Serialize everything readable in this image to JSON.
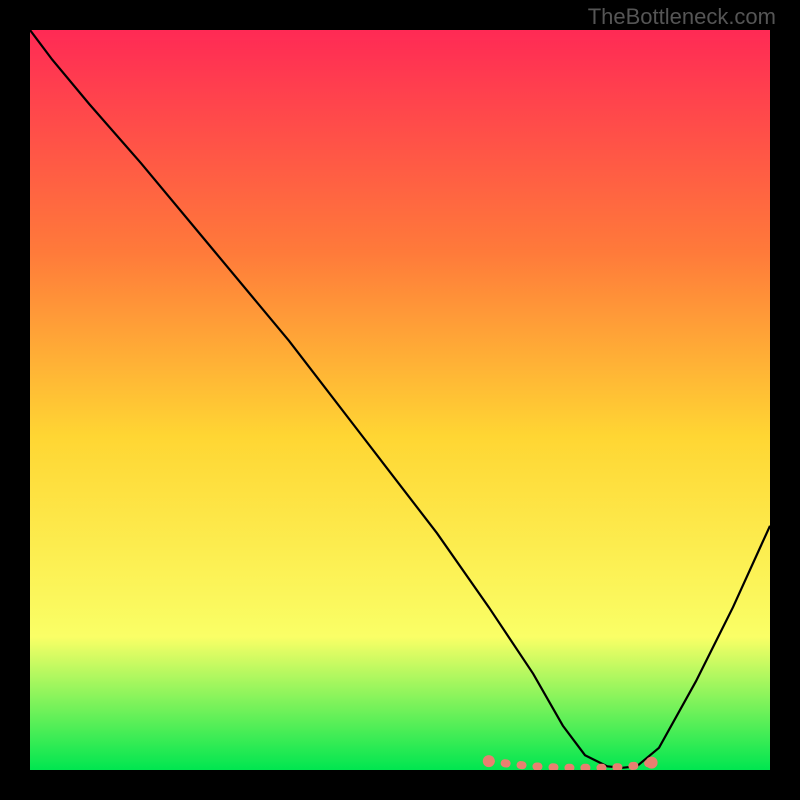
{
  "watermark": "TheBottleneck.com",
  "chart_data": {
    "type": "line",
    "title": "",
    "xlabel": "",
    "ylabel": "",
    "xlim": [
      0,
      100
    ],
    "ylim": [
      0,
      100
    ],
    "gradient_colors": {
      "top": "#ff2a55",
      "upper_mid": "#ff7a3a",
      "mid": "#ffd633",
      "lower_mid": "#faff66",
      "bottom": "#00e650"
    },
    "curve": {
      "x": [
        0,
        3,
        8,
        15,
        25,
        35,
        45,
        55,
        62,
        68,
        72,
        75,
        78,
        80,
        82,
        85,
        90,
        95,
        100
      ],
      "y": [
        100,
        96,
        90,
        82,
        70,
        58,
        45,
        32,
        22,
        13,
        6,
        2,
        0.5,
        0.3,
        0.5,
        3,
        12,
        22,
        33
      ]
    },
    "highlight_segment": {
      "color": "#e88070",
      "x": [
        62,
        65,
        68,
        70,
        72,
        74,
        76,
        78,
        80,
        82,
        84
      ],
      "y": [
        1.2,
        0.8,
        0.5,
        0.4,
        0.3,
        0.3,
        0.3,
        0.3,
        0.4,
        0.6,
        1.0
      ]
    }
  }
}
